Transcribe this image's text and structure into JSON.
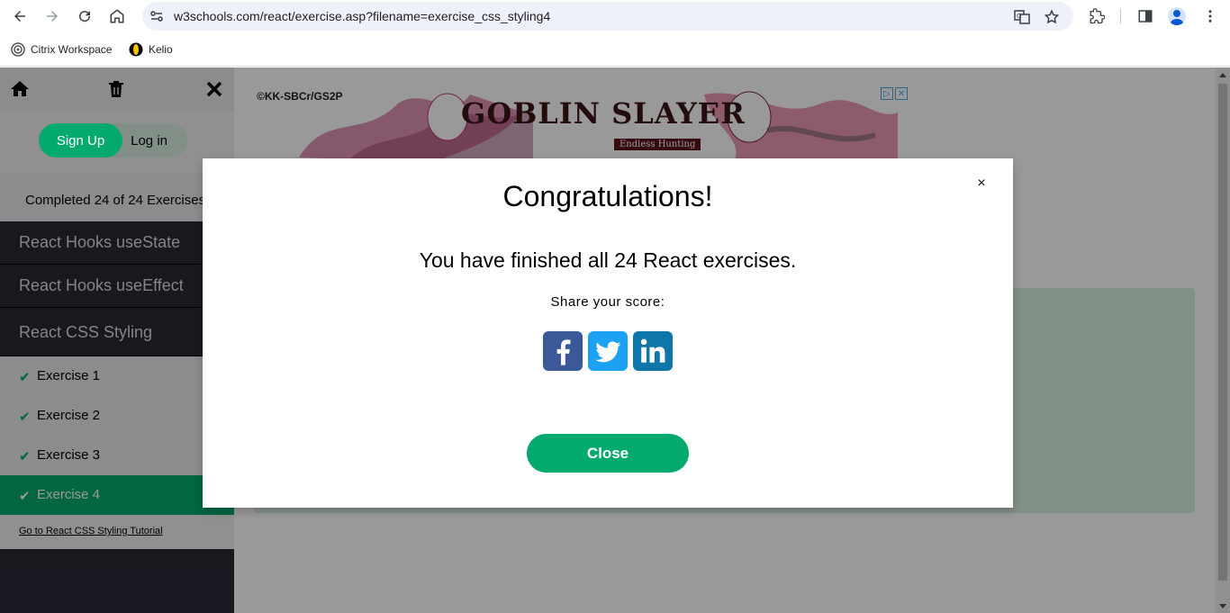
{
  "browser": {
    "url": "w3schools.com/react/exercise.asp?filename=exercise_css_styling4",
    "bookmarks": [
      {
        "label": "Citrix Workspace",
        "icon": "citrix-icon"
      },
      {
        "label": "Kelio",
        "icon": "kelio-icon"
      }
    ]
  },
  "sidebar": {
    "signup_label": "Sign Up",
    "login_label": "Log in",
    "completed_text": "Completed 24 of 24 Exercises:",
    "sections": [
      {
        "label": "React Hooks useState"
      },
      {
        "label": "React Hooks useEffect"
      },
      {
        "label": "React CSS Styling"
      }
    ],
    "exercises": [
      {
        "label": "Exercise 1",
        "done": true
      },
      {
        "label": "Exercise 2",
        "done": true
      },
      {
        "label": "Exercise 3",
        "done": true
      },
      {
        "label": "Exercise 4",
        "done": true,
        "active": true
      }
    ],
    "tutorial_link": "Go to React CSS Styling Tutorial"
  },
  "ad": {
    "copyright": "©KK-SBCr/GS2P",
    "title": "GOBLIN SLAYER",
    "subtitle": "Endless Hunting"
  },
  "modal": {
    "title": "Congratulations!",
    "message": "You have finished all 24 React exercises.",
    "share_label": "Share your score:",
    "close_label": "Close",
    "close_x": "×"
  },
  "colors": {
    "accent": "#04aa6d",
    "sidebar_dark": "#282a35",
    "facebook": "#3b5998",
    "twitter": "#1da1f2",
    "linkedin": "#0e76a8"
  }
}
